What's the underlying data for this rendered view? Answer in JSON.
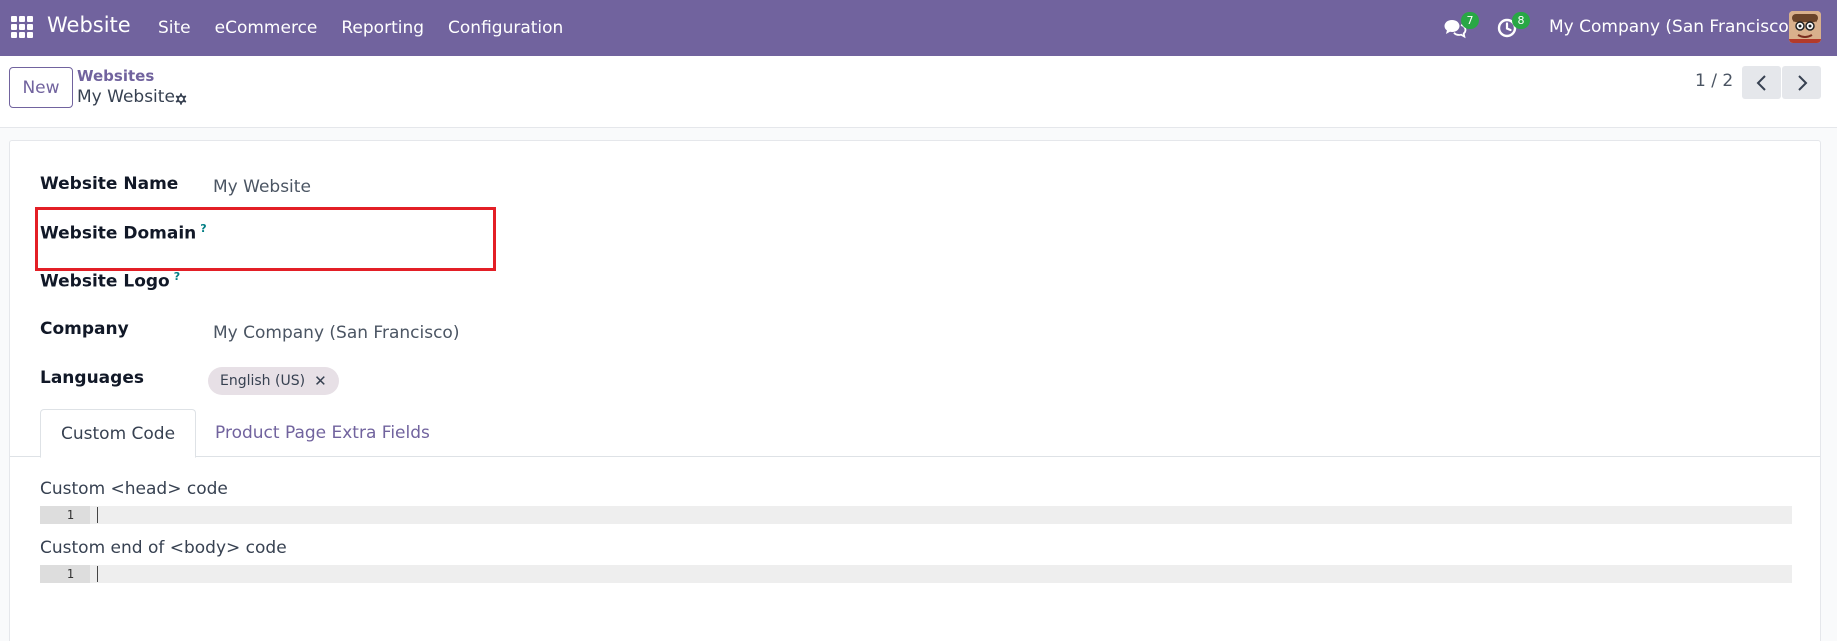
{
  "navbar": {
    "app_name": "Website",
    "menu": [
      "Site",
      "eCommerce",
      "Reporting",
      "Configuration"
    ],
    "chat_count": "7",
    "activity_count": "8",
    "company": "My Company (San Francisco)",
    "bg_color": "#71639e"
  },
  "control_panel": {
    "new_label": "New",
    "breadcrumb_parent": "Websites",
    "breadcrumb_current": "My Website",
    "pager": "1 / 2"
  },
  "form": {
    "website_name_label": "Website Name",
    "website_name_value": "My Website",
    "website_domain_label": "Website Domain",
    "website_logo_label": "Website Logo",
    "company_label": "Company",
    "company_value": "My Company (San Francisco)",
    "languages_label": "Languages",
    "language_tag": "English (US)",
    "help_mark": "?"
  },
  "tabs": {
    "custom_code": "Custom Code",
    "product_page_extra_fields": "Product Page Extra Fields"
  },
  "custom_code": {
    "head_label": "Custom <head> code",
    "body_label": "Custom end of <body> code",
    "line_number": "1"
  },
  "colors": {
    "accent": "#71639e",
    "highlight": "#e31f26",
    "badge": "#28a745"
  }
}
